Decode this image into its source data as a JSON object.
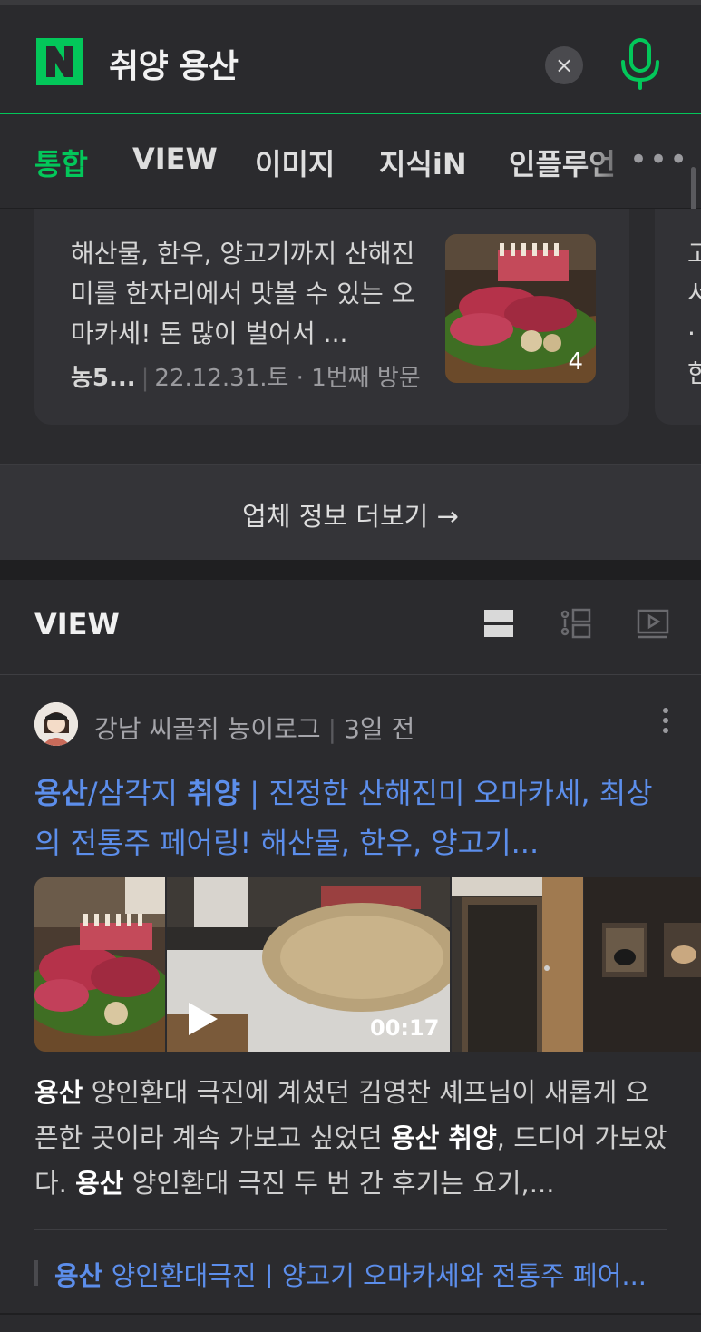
{
  "header": {
    "logo_letter": "N",
    "query": "취양 용산",
    "clear_glyph": "×"
  },
  "tabs": [
    {
      "label": "통합",
      "active": true
    },
    {
      "label": "VIEW",
      "active": false
    },
    {
      "label": "이미지",
      "active": false
    },
    {
      "label": "지식iN",
      "active": false
    },
    {
      "label": "인플루언",
      "active": false
    }
  ],
  "tabs_more_glyph": "•••",
  "review_card": {
    "text": "해산물, 한우, 양고기까지 산해진미를 한자리에서 맛볼 수 있는 오마카세! 돈 많이 벌어서 ...",
    "author": "농5...",
    "date": "22.12.31.토",
    "visit": "1번째 방문",
    "photo_count": "4"
  },
  "next_card_lines": [
    "고",
    "서",
    "·",
    "한"
  ],
  "more_info": {
    "label": "업체 정보 더보기 →"
  },
  "view_section": {
    "title": "VIEW",
    "icons": [
      "list-view-icon",
      "thumbnail-view-icon",
      "video-view-icon"
    ]
  },
  "post": {
    "author": "강남 씨골쥐 농이로그",
    "time": "3일 전",
    "title_parts": [
      {
        "text": "용산",
        "bold": true
      },
      {
        "text": "/삼각지 ",
        "bold": false
      },
      {
        "text": "취양",
        "bold": true
      },
      {
        "text": " | 진정한 산해진미 오마카세, 최상의 전통주 페어링! 해산물, 한우, 양고기...",
        "bold": false
      }
    ],
    "video_duration": "00:17",
    "snippet_parts": [
      {
        "text": "용산",
        "bold": true
      },
      {
        "text": " 양인환대 극진에 계셨던 김영찬 셰프님이 새롭게 오픈한 곳이라 계속 가보고 싶었던 ",
        "bold": false
      },
      {
        "text": "용산 취양",
        "bold": true
      },
      {
        "text": ", 드디어 가보았다. ",
        "bold": false
      },
      {
        "text": "용산",
        "bold": true
      },
      {
        "text": " 양인환대 극진 두 번 간 후기는 요기,...",
        "bold": false
      }
    ],
    "related_parts": [
      {
        "text": "용산",
        "bold": true
      },
      {
        "text": " 양인환대극진 | 양고기 오마카세와 전통주 페어...",
        "bold": false
      }
    ]
  },
  "colors": {
    "accent_green": "#03c75a",
    "link_blue": "#5c8eeb",
    "background": "#2b2b2e"
  }
}
